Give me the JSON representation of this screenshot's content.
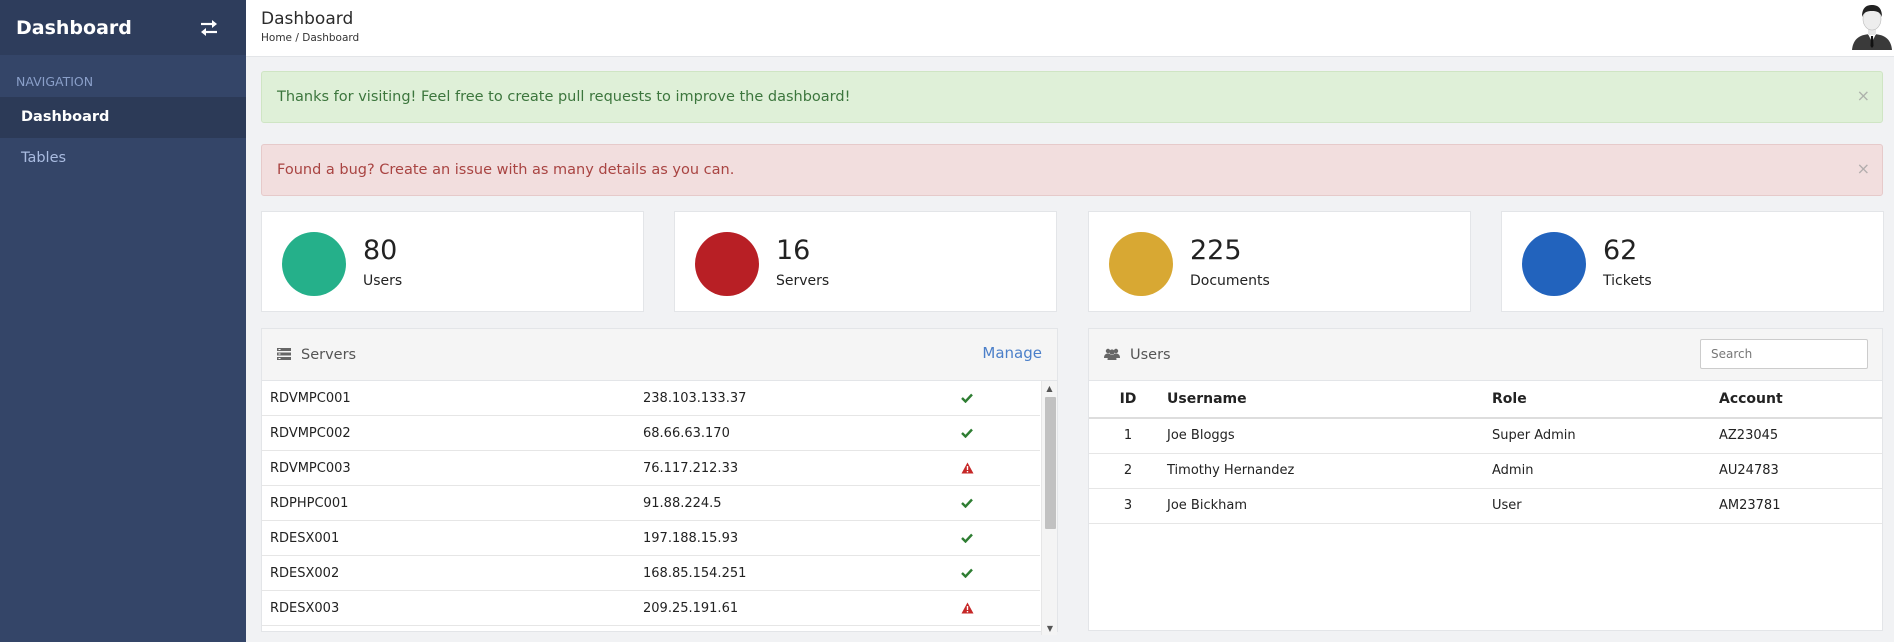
{
  "sidebar": {
    "brand": "Dashboard",
    "nav_label": "NAVIGATION",
    "items": [
      {
        "label": "Dashboard",
        "active": true
      },
      {
        "label": "Tables",
        "active": false
      }
    ]
  },
  "header": {
    "title": "Dashboard",
    "breadcrumb": [
      "Home",
      "Dashboard"
    ],
    "breadcrumb_sep": "/"
  },
  "alerts": [
    {
      "type": "success",
      "text": "Thanks for visiting! Feel free to create pull requests to improve the dashboard!",
      "close": "×"
    },
    {
      "type": "danger",
      "text": "Found a bug? Create an issue with as many details as you can.",
      "close": "×"
    }
  ],
  "stats": [
    {
      "value": "80",
      "label": "Users",
      "color": "#25b08a"
    },
    {
      "value": "16",
      "label": "Servers",
      "color": "#b81f25"
    },
    {
      "value": "225",
      "label": "Documents",
      "color": "#d8a833"
    },
    {
      "value": "62",
      "label": "Tickets",
      "color": "#2263bd"
    }
  ],
  "servers_panel": {
    "title": "Servers",
    "icon": "server-list-icon",
    "manage_label": "Manage",
    "rows": [
      {
        "name": "RDVMPC001",
        "ip": "238.103.133.37",
        "status": "ok"
      },
      {
        "name": "RDVMPC002",
        "ip": "68.66.63.170",
        "status": "ok"
      },
      {
        "name": "RDVMPC003",
        "ip": "76.117.212.33",
        "status": "warning"
      },
      {
        "name": "RDPHPC001",
        "ip": "91.88.224.5",
        "status": "ok"
      },
      {
        "name": "RDESX001",
        "ip": "197.188.15.93",
        "status": "ok"
      },
      {
        "name": "RDESX002",
        "ip": "168.85.154.251",
        "status": "ok"
      },
      {
        "name": "RDESX003",
        "ip": "209.25.191.61",
        "status": "warning"
      }
    ]
  },
  "users_panel": {
    "title": "Users",
    "icon": "users-icon",
    "search_placeholder": "Search",
    "columns": [
      "ID",
      "Username",
      "Role",
      "Account"
    ],
    "rows": [
      {
        "id": "1",
        "username": "Joe Bloggs",
        "role": "Super Admin",
        "account": "AZ23045"
      },
      {
        "id": "2",
        "username": "Timothy Hernandez",
        "role": "Admin",
        "account": "AU24783"
      },
      {
        "id": "3",
        "username": "Joe Bickham",
        "role": "User",
        "account": "AM23781"
      }
    ]
  },
  "colors": {
    "sidebar_bg": "#344568",
    "ok": "#2e7d32",
    "warning": "#c62828",
    "link": "#4b7fc9"
  }
}
